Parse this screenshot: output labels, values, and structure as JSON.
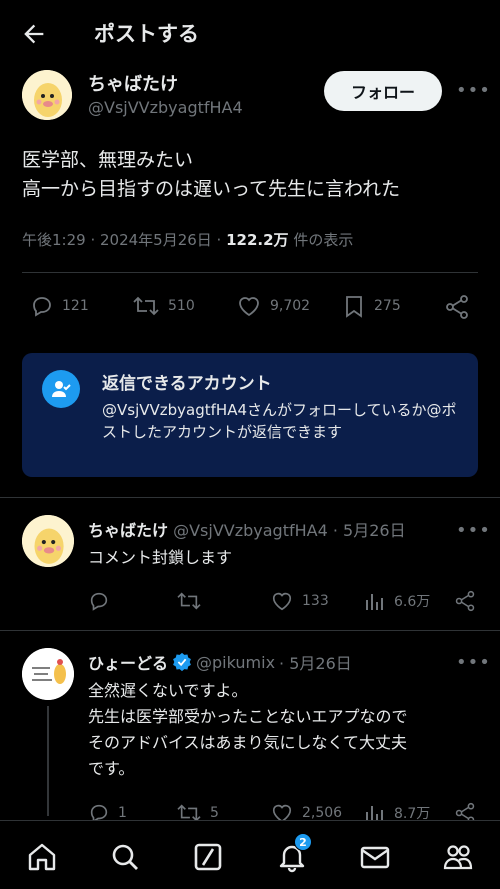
{
  "header": {
    "title": "ポストする"
  },
  "post": {
    "name": "ちゃばたけ",
    "handle": "@VsjVVzbyagtfHA4",
    "follow_label": "フォロー",
    "text_line1": "医学部、無理みたい",
    "text_line2": "高一から目指すのは遅いって先生に言われた",
    "time": "午後1:29 · 2024年5月26日 · ",
    "views": "122.2万",
    "views_suffix": " 件の表示",
    "replies": "121",
    "reposts": "510",
    "likes": "9,702",
    "bookmarks": "275"
  },
  "notice": {
    "title": "返信できるアカウント",
    "body": "@VsjVVzbyagtfHA4さんがフォローしているか@ポストしたアカウントが返信できます"
  },
  "replies": [
    {
      "name": "ちゃばたけ",
      "handle": "@VsjVVzbyagtfHA4",
      "date": "· 5月26日",
      "text": "コメント封鎖します",
      "likes": "133",
      "views": "6.6万"
    },
    {
      "name": "ひょーどる",
      "handle": "@pikumix",
      "date": "· 5月26日",
      "text_line1": "全然遅くないですよ。",
      "text_line2": "先生は医学部受かったことないエアプなので",
      "text_line3": "そのアドバイスはあまり気にしなくて大丈夫",
      "text_line4": "です。",
      "replies": "1",
      "reposts": "5",
      "likes": "2,506",
      "views": "8.7万"
    }
  ],
  "bottom_nav": {
    "notification_count": "2"
  },
  "colors": {
    "accent": "#1d9bf0",
    "notice_bg": "#0b1e4a",
    "muted": "#71767b"
  }
}
